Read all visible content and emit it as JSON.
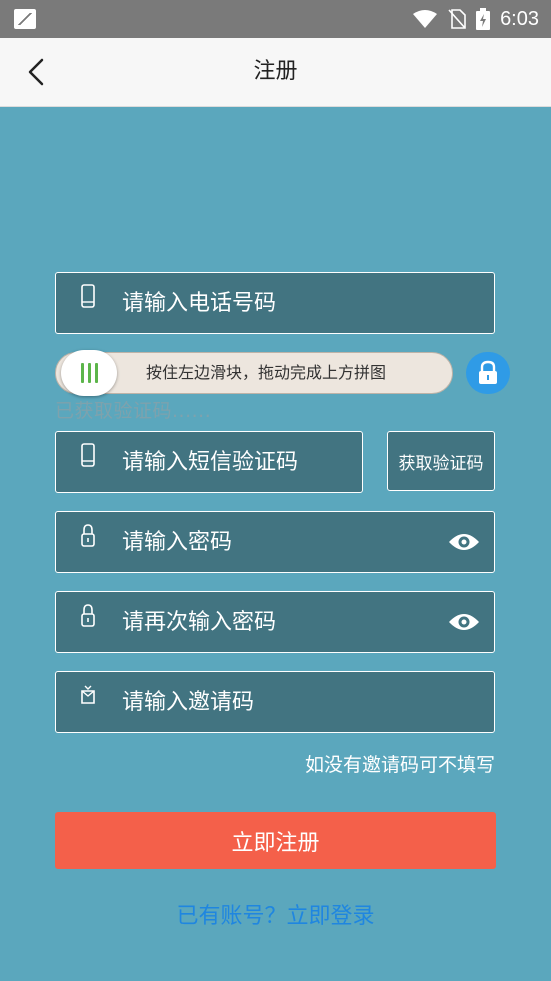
{
  "status_bar": {
    "time": "6:03"
  },
  "app_bar": {
    "title": "注册"
  },
  "form": {
    "phone_placeholder": "请输入电话号码",
    "slider_text": "按住左边滑块，拖动完成上方拼图",
    "slider_hint": "已获取验证码......",
    "sms_placeholder": "请输入短信验证码",
    "get_code_label": "获取验证码",
    "password_placeholder": "请输入密码",
    "confirm_password_placeholder": "请再次输入密码",
    "invite_placeholder": "请输入邀请码",
    "invite_note": "如没有邀请码可不填写",
    "register_label": "立即注册",
    "login_link": "已有账号？立即登录"
  },
  "colors": {
    "background": "#5ba7bd",
    "field": "#427481",
    "register_button": "#f4604a",
    "link": "#1f86e0"
  },
  "icons": [
    "phone-icon",
    "lock-icon",
    "eye-icon",
    "invite-icon",
    "back-arrow-icon"
  ]
}
